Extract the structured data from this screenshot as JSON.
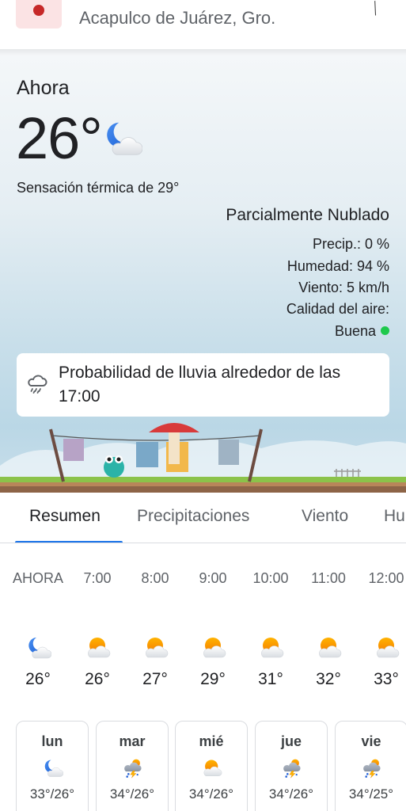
{
  "location": {
    "name": "Acapulco de Juárez, Gro."
  },
  "current": {
    "label": "Ahora",
    "temperature": "26°",
    "condition_icon": "partly-cloudy-night-icon",
    "feels_like": "Sensación térmica de 29°",
    "condition": "Parcialmente Nublado",
    "precip": "Precip.: 0 %",
    "humidity": "Humedad: 94 %",
    "wind": "Viento: 5 km/h",
    "air_quality_label": "Calidad del aire:",
    "air_quality_value": "Buena",
    "air_quality_color": "#1ec94c"
  },
  "rain_notice": {
    "icon": "rain-cloud-icon",
    "text": "Probabilidad de lluvia alrededor de las 17:00"
  },
  "tabs": [
    {
      "label": "Resumen",
      "active": true
    },
    {
      "label": "Precipitaciones",
      "active": false
    },
    {
      "label": "Viento",
      "active": false
    },
    {
      "label": "Hu",
      "active": false
    }
  ],
  "accent_color": "#1a73e8",
  "hourly": [
    {
      "time": "AHORA",
      "icon": "partly-cloudy-night-icon",
      "temp": "26°"
    },
    {
      "time": "7:00",
      "icon": "partly-cloudy-day-icon",
      "temp": "26°"
    },
    {
      "time": "8:00",
      "icon": "partly-cloudy-day-icon",
      "temp": "27°"
    },
    {
      "time": "9:00",
      "icon": "partly-cloudy-day-icon",
      "temp": "29°"
    },
    {
      "time": "10:00",
      "icon": "partly-cloudy-day-icon",
      "temp": "31°"
    },
    {
      "time": "11:00",
      "icon": "partly-cloudy-day-icon",
      "temp": "32°"
    },
    {
      "time": "12:00",
      "icon": "partly-cloudy-day-icon",
      "temp": "33°"
    }
  ],
  "daily": [
    {
      "day": "lun",
      "icon": "partly-cloudy-night-icon",
      "range": "33°/26°"
    },
    {
      "day": "mar",
      "icon": "thunderstorm-icon",
      "range": "34°/26°"
    },
    {
      "day": "mié",
      "icon": "partly-cloudy-day-icon",
      "range": "34°/26°"
    },
    {
      "day": "jue",
      "icon": "thunderstorm-icon",
      "range": "34°/26°"
    },
    {
      "day": "vie",
      "icon": "thunderstorm-icon",
      "range": "34°/25°"
    }
  ]
}
